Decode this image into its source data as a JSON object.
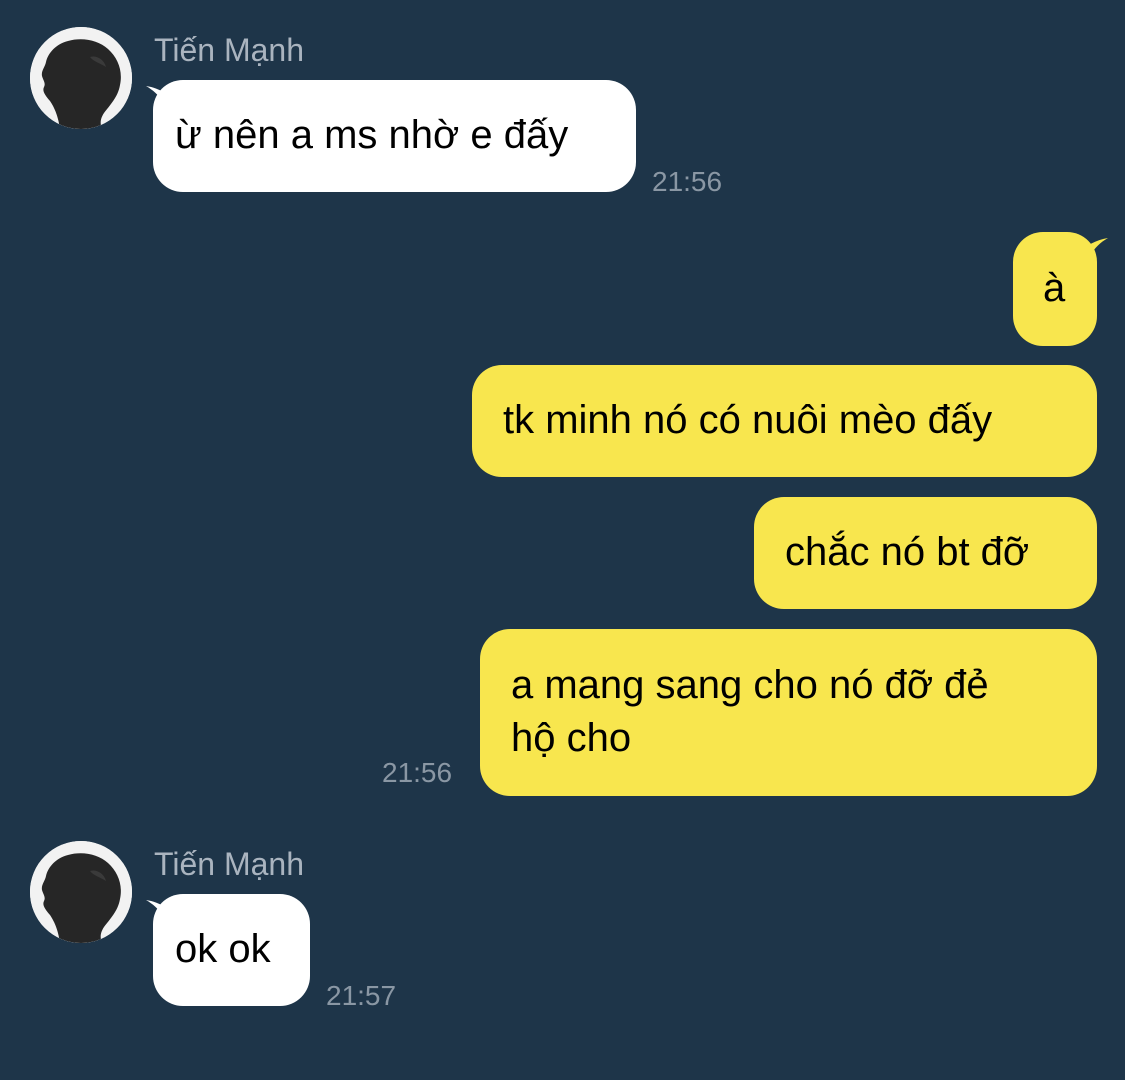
{
  "chat": {
    "colors": {
      "background": "#1e3549",
      "incoming_bubble": "#ffffff",
      "outgoing_bubble": "#f8e64e",
      "name_text": "#aab4bf",
      "time_text": "#8a97a4"
    },
    "messages": [
      {
        "direction": "incoming",
        "sender": "Tiến Mạnh",
        "avatar_icon": "profile-avatar-icon",
        "text": "ừ nên a ms nhờ e đấy",
        "time": "21:56"
      },
      {
        "direction": "outgoing",
        "text": "à"
      },
      {
        "direction": "outgoing",
        "text": "tk minh nó có nuôi mèo đấy"
      },
      {
        "direction": "outgoing",
        "text": "chắc nó bt đỡ"
      },
      {
        "direction": "outgoing",
        "text_line1": "a mang sang cho nó đỡ đẻ",
        "text_line2": "hộ cho",
        "time": "21:56"
      },
      {
        "direction": "incoming",
        "sender": "Tiến Mạnh",
        "avatar_icon": "profile-avatar-icon",
        "text": "ok ok",
        "time": "21:57"
      }
    ]
  }
}
